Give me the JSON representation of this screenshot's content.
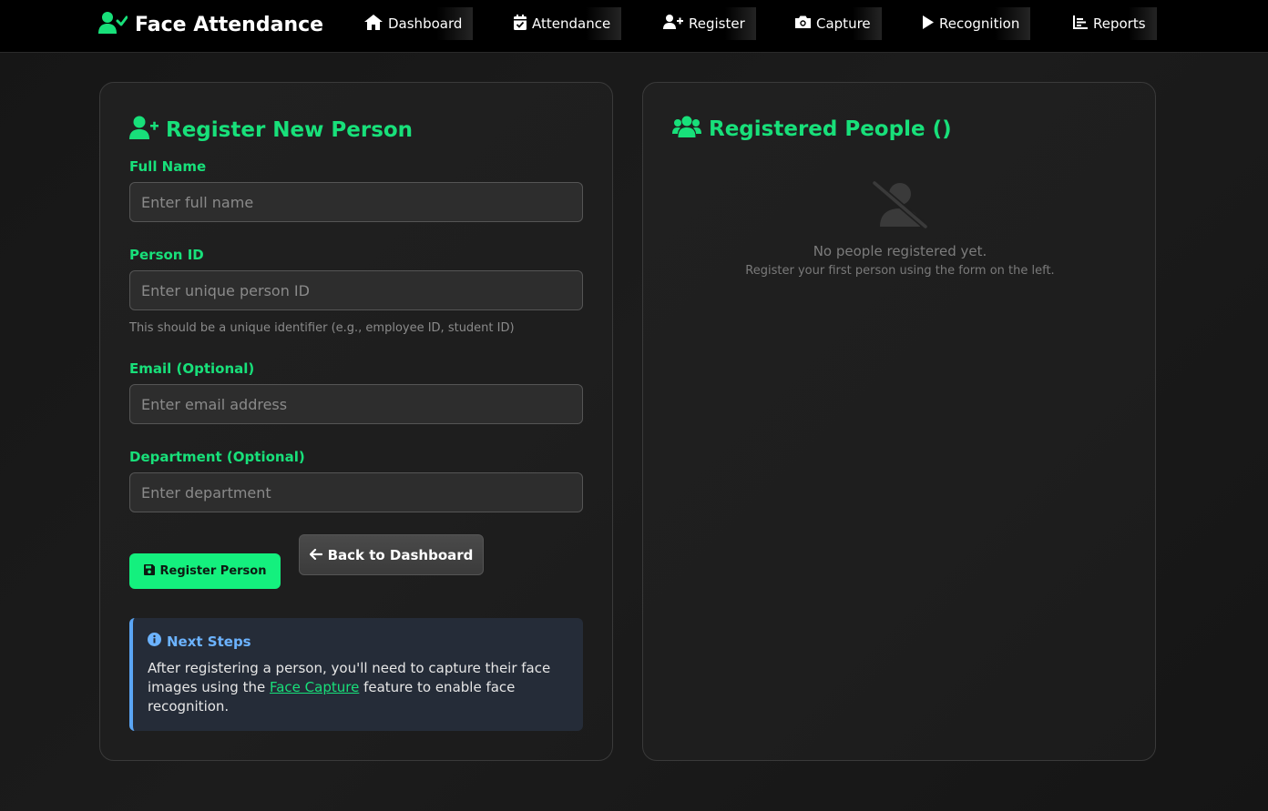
{
  "nav": {
    "brand": "Face Attendance",
    "brand_icon": "user-check-icon",
    "items": [
      {
        "label": "Dashboard",
        "icon": "home-icon"
      },
      {
        "label": "Attendance",
        "icon": "calendar-check-icon"
      },
      {
        "label": "Register",
        "icon": "user-plus-icon"
      },
      {
        "label": "Capture",
        "icon": "camera-icon"
      },
      {
        "label": "Recognition",
        "icon": "play-icon"
      },
      {
        "label": "Reports",
        "icon": "chart-icon"
      }
    ]
  },
  "form": {
    "title": "Register New Person",
    "fields": {
      "full_name": {
        "label": "Full Name",
        "placeholder": "Enter full name",
        "value": ""
      },
      "person_id": {
        "label": "Person ID",
        "placeholder": "Enter unique person ID",
        "value": "",
        "help": "This should be a unique identifier (e.g., employee ID, student ID)"
      },
      "email": {
        "label": "Email (Optional)",
        "placeholder": "Enter email address",
        "value": ""
      },
      "department": {
        "label": "Department (Optional)",
        "placeholder": "Enter department",
        "value": ""
      }
    },
    "register_button": "Register Person",
    "back_button": "Back to Dashboard",
    "info": {
      "title": "Next Steps",
      "text_before": "After registering a person, you'll need to capture their face images using the ",
      "link": "Face Capture",
      "text_after": " feature to enable face recognition."
    }
  },
  "registered": {
    "title": "Registered People ()",
    "empty_title": "No people registered yet.",
    "empty_subtitle": "Register your first person using the form on the left."
  },
  "colors": {
    "accent": "#18e07a",
    "info": "#6cb3ff",
    "background": "#161616"
  }
}
